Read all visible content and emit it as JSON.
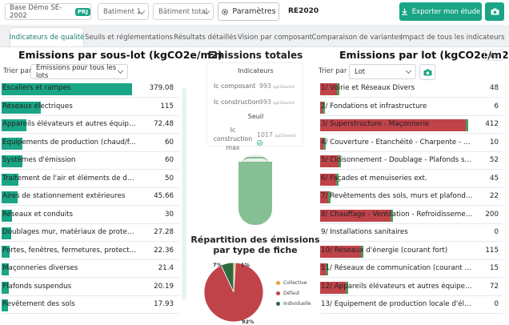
{
  "topbar": {
    "project": "Base Démo SE-2002",
    "project_badge": "PRJ",
    "batiment": "Batiment 1",
    "batiment_total": "Bâtiment total",
    "parametres": "Paramètres",
    "re2020": "RE2020",
    "export": "Exporter mon étude"
  },
  "tabs": [
    {
      "label": "Indicateurs de qualité"
    },
    {
      "label": "Seuils et réglementations"
    },
    {
      "label": "Résultats détaillés"
    },
    {
      "label": "Vision par composant"
    },
    {
      "label": "Comparaison de variantes"
    },
    {
      "label": "Impact de tous les indicateurs"
    }
  ],
  "left": {
    "title": "Emissions par sous-lot (kgCO2e/m2)",
    "sort_label": "Trier par",
    "sort_value": "Emissions pour tous les lots",
    "bar_color": "#1aa586",
    "rows": [
      {
        "label": "Escaliers et rampes",
        "value": 379.08
      },
      {
        "label": "Réseaux électriques",
        "value": 115
      },
      {
        "label": "Appareils élévateurs et autres équipe...",
        "value": 72.48
      },
      {
        "label": "Equipements de production (chaud/f...",
        "value": 60
      },
      {
        "label": "Systèmes d'émission",
        "value": 60
      },
      {
        "label": "Traitement de l'air et éléments de dés...",
        "value": 50
      },
      {
        "label": "Aires de stationnement extérieures",
        "value": 45.66
      },
      {
        "label": "Réseaux et conduits",
        "value": 30
      },
      {
        "label": "Doublages mur, matériaux de protect...",
        "value": 27.28
      },
      {
        "label": "Portes, fenêtres, fermetures, protectio...",
        "value": 22.36
      },
      {
        "label": "Maçonneries diverses",
        "value": 21.4
      },
      {
        "label": "Plafonds suspendus",
        "value": 20.19
      },
      {
        "label": "Revêtement des sols",
        "value": 17.93
      }
    ]
  },
  "middle": {
    "title": "Emissions totales",
    "indicators_title": "Indicateurs",
    "ic_composant_label": "Ic composant",
    "ic_composant_value": "993",
    "ic_construction_label": "Ic construction",
    "ic_construction_value": "993",
    "unit": "kgCO2e/m2",
    "seuil_title": "Seuil",
    "ic_max_label_1": "Ic construction",
    "ic_max_label_2": "max",
    "ic_max_value": "1017",
    "fill_fraction": 0.9,
    "repartition_title": "Répartition des émissions par type de fiche",
    "legend": [
      {
        "label": "Collective",
        "color": "#f0a030"
      },
      {
        "label": "Défaut",
        "color": "#c0434a"
      },
      {
        "label": "Individuelle",
        "color": "#2d6a3e"
      }
    ],
    "pie": [
      {
        "label": "1%",
        "value": 1,
        "color": "#f0a030"
      },
      {
        "label": "92%",
        "value": 92,
        "color": "#c0434a"
      },
      {
        "label": "7%",
        "value": 7,
        "color": "#2d6a3e"
      }
    ]
  },
  "right": {
    "title": "Emissions par lot (kgCO2e/m2)",
    "sort_label": "Trier par",
    "sort_value": "Lot",
    "bar_color": "#c0434a",
    "green_color": "#4e9a5a",
    "rows": [
      {
        "label": "1/ Voirie et Réseaux Divers",
        "value": 48
      },
      {
        "label": "2/ Fondations et infrastructure",
        "value": 6
      },
      {
        "label": "3/ Superstructure - Maçonnerie",
        "value": 412
      },
      {
        "label": "4/ Couverture - Etanchéité - Charpente - Zi...",
        "value": 10
      },
      {
        "label": "5/ Cloisonnement - Doublage - Plafonds su...",
        "value": 52
      },
      {
        "label": "6/ Façades et menuiseries ext.",
        "value": 45
      },
      {
        "label": "7/ Revêtements des sols, murs et plafonds ...",
        "value": 22
      },
      {
        "label": "8/ Chauffage - Ventilation - Refroidissemen...",
        "value": 200
      },
      {
        "label": "9/ Installations sanitaires",
        "value": 0
      },
      {
        "label": "10/ Réseaux d'énergie (courant fort)",
        "value": 115
      },
      {
        "label": "11/ Réseaux de communication (courant f...",
        "value": 15
      },
      {
        "label": "12/ Appareils élévateurs et autres équipem...",
        "value": 72
      },
      {
        "label": "13/ Equipement de production locale d'élé...",
        "value": 0
      }
    ]
  }
}
